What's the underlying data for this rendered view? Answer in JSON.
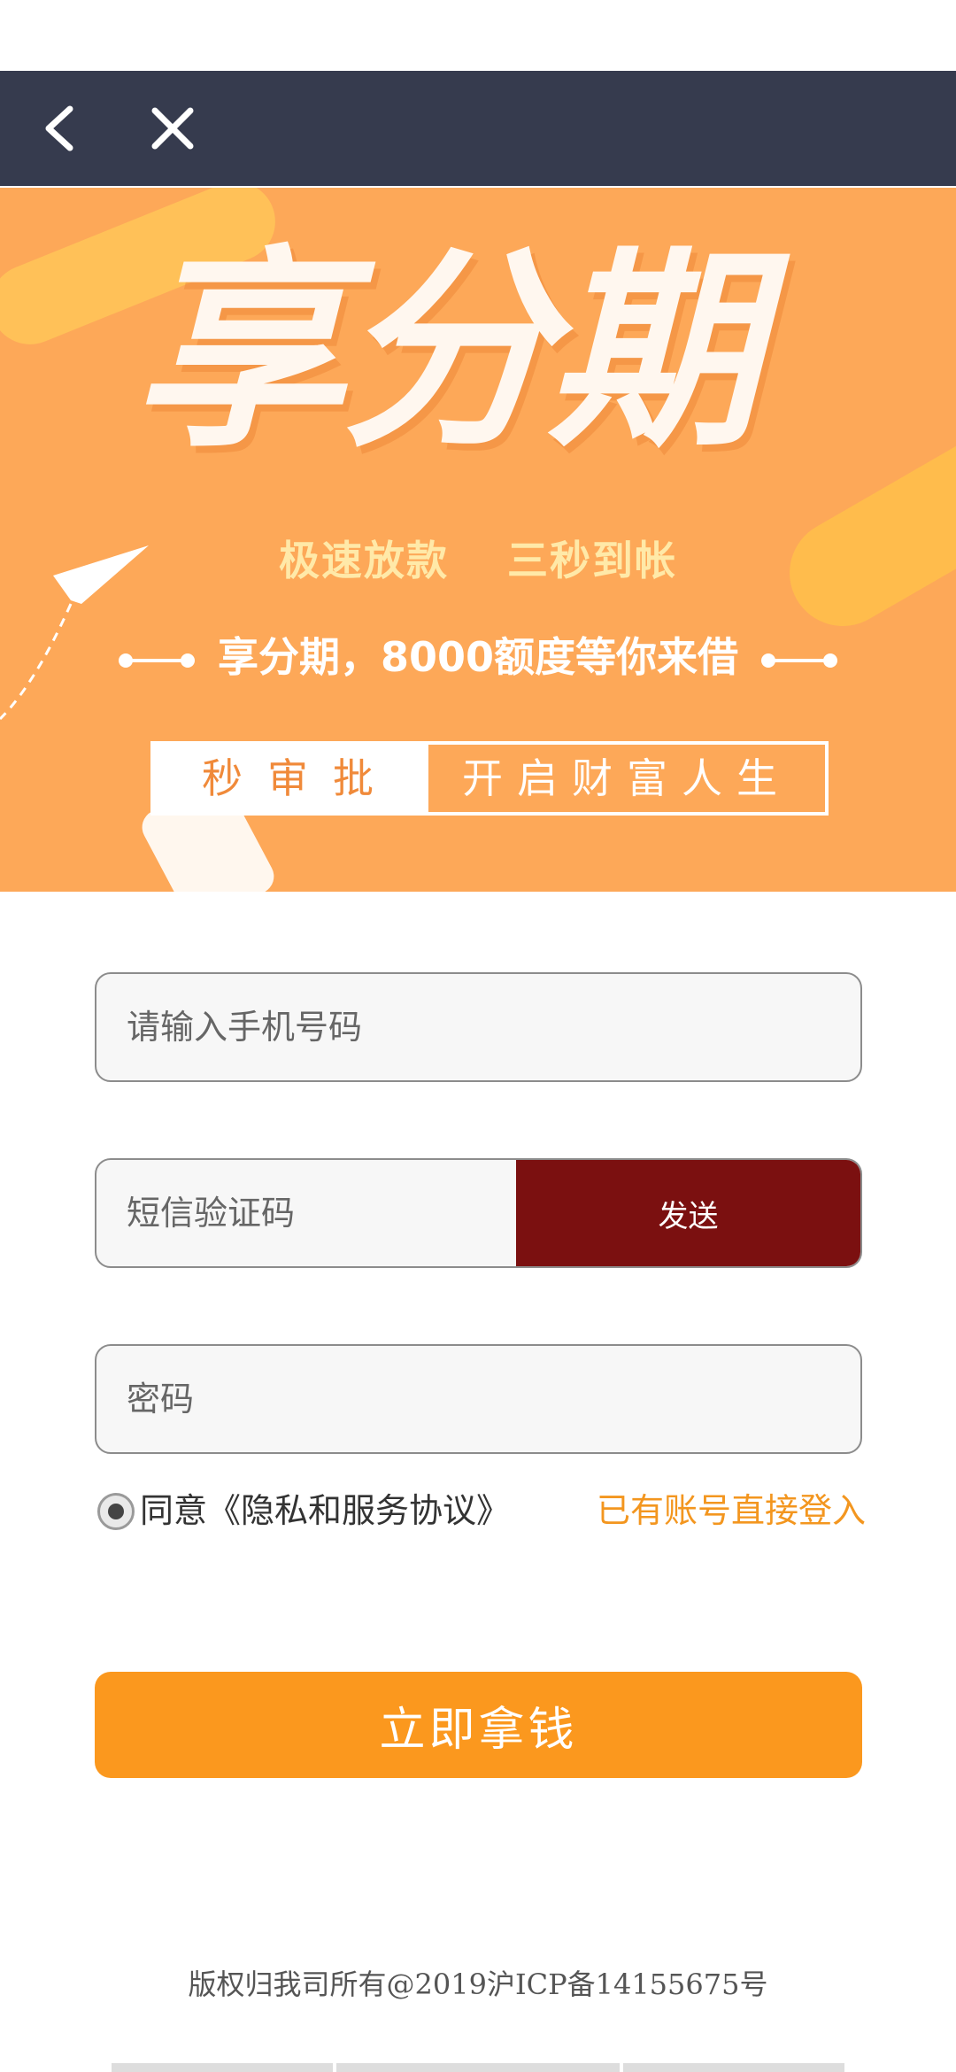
{
  "nav": {
    "back_icon": "chevron-left-icon",
    "close_icon": "close-icon"
  },
  "banner": {
    "title": "享分期",
    "slogan_left": "极速放款",
    "slogan_right": "三秒到帐",
    "tagline": "享分期，8000额度等你来借",
    "box_left": "秒审批",
    "box_right": "开启财富人生",
    "coin_symbol": "¥"
  },
  "form": {
    "phone_placeholder": "请输入手机号码",
    "sms_placeholder": "短信验证码",
    "send_label": "发送",
    "password_placeholder": "密码",
    "agree_label": "同意《隐私和服务协议》",
    "login_link": "已有账号直接登入",
    "submit_label": "立即拿钱"
  },
  "footer": {
    "copyright": "版权归我司所有@2019沪ICP备14155675号"
  },
  "colors": {
    "navbar": "#363b4e",
    "banner": "#fda858",
    "send_button": "#7b1010",
    "submit_button": "#fb981e",
    "link": "#f3961f"
  }
}
